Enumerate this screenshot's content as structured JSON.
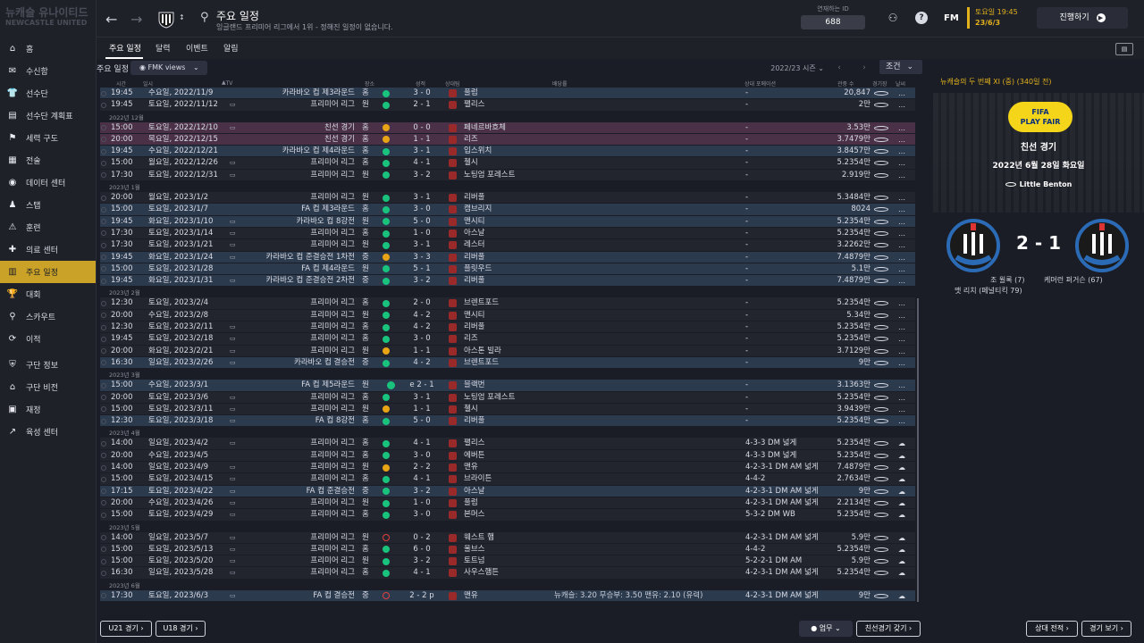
{
  "sidebar": {
    "club": [
      "뉴캐슬 유나이티드",
      "NEWCASTLE UNITED"
    ],
    "items": [
      {
        "label": "홈",
        "icon": "home-icon"
      },
      {
        "label": "수신함",
        "icon": "inbox-icon"
      },
      {
        "label": "선수단",
        "icon": "shirt-icon"
      },
      {
        "label": "선수단 계획표",
        "icon": "clipboard-icon"
      },
      {
        "label": "세력 구도",
        "icon": "hierarchy-icon"
      },
      {
        "label": "전술",
        "icon": "tactics-icon"
      },
      {
        "label": "데이터 센터",
        "icon": "data-icon"
      },
      {
        "label": "스탭",
        "icon": "staff-icon"
      },
      {
        "label": "훈련",
        "icon": "training-icon"
      },
      {
        "label": "의료 센터",
        "icon": "medical-icon"
      },
      {
        "label": "주요 일정",
        "icon": "calendar-icon",
        "active": true
      },
      {
        "label": "대회",
        "icon": "trophy-icon"
      },
      {
        "label": "스카우트",
        "icon": "scout-icon"
      },
      {
        "label": "이적",
        "icon": "transfer-icon"
      },
      {
        "label": "구단 정보",
        "icon": "shield-icon"
      },
      {
        "label": "구단 비전",
        "icon": "vision-icon"
      },
      {
        "label": "재정",
        "icon": "finance-icon"
      },
      {
        "label": "육성 센터",
        "icon": "development-icon"
      }
    ]
  },
  "header": {
    "title": "주요 일정",
    "subtitle": "잉글랜드 프리미어 리그에서 1위 - 정해진 일정이 없습니다.",
    "id_label": "연재하는 ID",
    "id_value": "688",
    "fm": "FM",
    "date_line1": "토요일 19:45",
    "date_line2": "23/6/3",
    "continue": "진행하기"
  },
  "tabs": [
    "주요 일정",
    "달력",
    "이벤트",
    "알림"
  ],
  "filters": {
    "label": "주요 일정",
    "views": "FMK views",
    "season": "2022/23 시즌",
    "conditions": "조건"
  },
  "columns": [
    "시간",
    "일시",
    "TV 대회",
    "장소",
    "성적",
    "상대팀",
    "배당률",
    "상대 포메이션",
    "관중 수",
    "경기장",
    "날씨"
  ],
  "rows": [
    {
      "type": "row",
      "time": "19:45",
      "date": "수요일, 2022/11/9",
      "tv": false,
      "comp": "카라바오 컵 제3라운드",
      "venue": "홈",
      "ind": "g",
      "res": "3 - 0",
      "opp": "풀럼",
      "note": "",
      "form": "-",
      "att": "20,847",
      "style": "alt"
    },
    {
      "type": "row",
      "time": "19:45",
      "date": "토요일, 2022/11/12",
      "tv": true,
      "comp": "프리미어 리그",
      "venue": "원",
      "ind": "g",
      "res": "2 - 1",
      "opp": "팰리스",
      "note": "",
      "form": "-",
      "att": "2만",
      "style": ""
    },
    {
      "type": "month",
      "label": "2022년 12월"
    },
    {
      "type": "row",
      "time": "15:00",
      "date": "토요일, 2022/12/10",
      "tv": true,
      "comp": "친선 경기",
      "venue": "홈",
      "ind": "y",
      "res": "0 - 0",
      "opp": "페네르바흐체",
      "note": "",
      "form": "-",
      "att": "3.53만",
      "style": "cup"
    },
    {
      "type": "row",
      "time": "20:00",
      "date": "목요일, 2022/12/15",
      "tv": false,
      "comp": "친선 경기",
      "venue": "홈",
      "ind": "y",
      "res": "1 - 1",
      "opp": "리즈",
      "note": "",
      "form": "-",
      "att": "3.7479만",
      "style": "cup"
    },
    {
      "type": "row",
      "time": "19:45",
      "date": "수요일, 2022/12/21",
      "tv": false,
      "comp": "카라바오 컵 제4라운드",
      "venue": "홈",
      "ind": "g",
      "res": "3 - 1",
      "opp": "입스위치",
      "note": "",
      "form": "-",
      "att": "3.8457만",
      "style": "alt"
    },
    {
      "type": "row",
      "time": "15:00",
      "date": "월요일, 2022/12/26",
      "tv": true,
      "comp": "프리미어 리그",
      "venue": "홈",
      "ind": "g",
      "res": "4 - 1",
      "opp": "첼시",
      "note": "",
      "form": "-",
      "att": "5.2354만",
      "style": ""
    },
    {
      "type": "row",
      "time": "17:30",
      "date": "토요일, 2022/12/31",
      "tv": true,
      "comp": "프리미어 리그",
      "venue": "원",
      "ind": "g",
      "res": "3 - 2",
      "opp": "노팅엄 포레스트",
      "note": "",
      "form": "-",
      "att": "2.919만",
      "style": ""
    },
    {
      "type": "month",
      "label": "2023년 1월"
    },
    {
      "type": "row",
      "time": "20:00",
      "date": "월요일, 2023/1/2",
      "tv": false,
      "comp": "프리미어 리그",
      "venue": "원",
      "ind": "g",
      "res": "3 - 1",
      "opp": "리버풀",
      "note": "",
      "form": "-",
      "att": "5.3484만",
      "style": ""
    },
    {
      "type": "row",
      "time": "15:00",
      "date": "토요일, 2023/1/7",
      "tv": false,
      "comp": "FA 컵 제3라운드",
      "venue": "홈",
      "ind": "g",
      "res": "3 - 0",
      "opp": "캠브리지",
      "note": "",
      "form": "-",
      "att": "8024",
      "style": "alt"
    },
    {
      "type": "row",
      "time": "19:45",
      "date": "화요일, 2023/1/10",
      "tv": true,
      "comp": "카라바오 컵 8강전",
      "venue": "원",
      "ind": "g",
      "res": "5 - 0",
      "opp": "맨시티",
      "note": "",
      "form": "-",
      "att": "5.2354만",
      "style": "alt"
    },
    {
      "type": "row",
      "time": "17:30",
      "date": "토요일, 2023/1/14",
      "tv": true,
      "comp": "프리미어 리그",
      "venue": "홈",
      "ind": "g",
      "res": "1 - 0",
      "opp": "아스날",
      "note": "",
      "form": "-",
      "att": "5.2354만",
      "style": ""
    },
    {
      "type": "row",
      "time": "17:30",
      "date": "토요일, 2023/1/21",
      "tv": true,
      "comp": "프리미어 리그",
      "venue": "원",
      "ind": "g",
      "res": "3 - 1",
      "opp": "레스터",
      "note": "",
      "form": "-",
      "att": "3.2262만",
      "style": ""
    },
    {
      "type": "row",
      "time": "19:45",
      "date": "화요일, 2023/1/24",
      "tv": true,
      "comp": "카라바오 컵 준결승전 1차전",
      "venue": "중",
      "ind": "y",
      "res": "3 - 3",
      "opp": "리버풀",
      "note": "",
      "form": "-",
      "att": "7.4879만",
      "style": "alt"
    },
    {
      "type": "row",
      "time": "15:00",
      "date": "토요일, 2023/1/28",
      "tv": false,
      "comp": "FA 컵 제4라운드",
      "venue": "원",
      "ind": "g",
      "res": "5 - 1",
      "opp": "플릿우드",
      "note": "",
      "form": "-",
      "att": "5.1만",
      "style": "alt"
    },
    {
      "type": "row",
      "time": "19:45",
      "date": "화요일, 2023/1/31",
      "tv": true,
      "comp": "카라바오 컵 준결승전 2차전",
      "venue": "중",
      "ind": "g",
      "res": "3 - 2",
      "opp": "리버풀",
      "note": "",
      "form": "-",
      "att": "7.4879만",
      "style": "alt"
    },
    {
      "type": "month",
      "label": "2023년 2월"
    },
    {
      "type": "row",
      "time": "12:30",
      "date": "토요일, 2023/2/4",
      "tv": false,
      "comp": "프리미어 리그",
      "venue": "홈",
      "ind": "g",
      "res": "2 - 0",
      "opp": "브렌트포드",
      "note": "",
      "form": "-",
      "att": "5.2354만",
      "style": ""
    },
    {
      "type": "row",
      "time": "20:00",
      "date": "수요일, 2023/2/8",
      "tv": false,
      "comp": "프리미어 리그",
      "venue": "원",
      "ind": "g",
      "res": "4 - 2",
      "opp": "맨시티",
      "note": "",
      "form": "-",
      "att": "5.34만",
      "style": ""
    },
    {
      "type": "row",
      "time": "12:30",
      "date": "토요일, 2023/2/11",
      "tv": true,
      "comp": "프리미어 리그",
      "venue": "홈",
      "ind": "g",
      "res": "4 - 2",
      "opp": "리버풀",
      "note": "",
      "form": "-",
      "att": "5.2354만",
      "style": ""
    },
    {
      "type": "row",
      "time": "19:45",
      "date": "토요일, 2023/2/18",
      "tv": true,
      "comp": "프리미어 리그",
      "venue": "홈",
      "ind": "g",
      "res": "3 - 0",
      "opp": "리즈",
      "note": "",
      "form": "-",
      "att": "5.2354만",
      "style": ""
    },
    {
      "type": "row",
      "time": "20:00",
      "date": "화요일, 2023/2/21",
      "tv": true,
      "comp": "프리미어 리그",
      "venue": "원",
      "ind": "y",
      "res": "1 - 1",
      "opp": "아스톤 빌라",
      "note": "",
      "form": "-",
      "att": "3.7129만",
      "style": ""
    },
    {
      "type": "row",
      "time": "16:30",
      "date": "일요일, 2023/2/26",
      "tv": true,
      "comp": "카라바오 컵 결승전",
      "venue": "중",
      "ind": "g",
      "res": "4 - 2",
      "opp": "브렌트포드",
      "note": "",
      "form": "-",
      "att": "9만",
      "style": "alt"
    },
    {
      "type": "month",
      "label": "2023년 3월"
    },
    {
      "type": "row",
      "time": "15:00",
      "date": "수요일, 2023/3/1",
      "tv": false,
      "comp": "FA 컵 제5라운드",
      "venue": "원",
      "ind": "b",
      "res": "e 2 - 1",
      "opp": "블랙번",
      "note": "",
      "form": "-",
      "att": "3.1363만",
      "style": "alt"
    },
    {
      "type": "row",
      "time": "20:00",
      "date": "토요일, 2023/3/6",
      "tv": true,
      "comp": "프리미어 리그",
      "venue": "홈",
      "ind": "g",
      "res": "3 - 1",
      "opp": "노팅엄 포레스트",
      "note": "",
      "form": "-",
      "att": "5.2354만",
      "style": ""
    },
    {
      "type": "row",
      "time": "15:00",
      "date": "토요일, 2023/3/11",
      "tv": true,
      "comp": "프리미어 리그",
      "venue": "원",
      "ind": "y",
      "res": "1 - 1",
      "opp": "첼시",
      "note": "",
      "form": "-",
      "att": "3.9439만",
      "style": ""
    },
    {
      "type": "row",
      "time": "12:30",
      "date": "토요일, 2023/3/18",
      "tv": true,
      "comp": "FA 컵 8강전",
      "venue": "홈",
      "ind": "g",
      "res": "5 - 0",
      "opp": "리버풀",
      "note": "",
      "form": "-",
      "att": "5.2354만",
      "style": "alt"
    },
    {
      "type": "month",
      "label": "2023년 4월"
    },
    {
      "type": "row",
      "time": "14:00",
      "date": "일요일, 2023/4/2",
      "tv": true,
      "comp": "프리미어 리그",
      "venue": "홈",
      "ind": "g",
      "res": "4 - 1",
      "opp": "팰리스",
      "note": "",
      "form": "4-3-3 DM 넓게",
      "att": "5.2354만",
      "style": ""
    },
    {
      "type": "row",
      "time": "20:00",
      "date": "수요일, 2023/4/5",
      "tv": false,
      "comp": "프리미어 리그",
      "venue": "홈",
      "ind": "g",
      "res": "3 - 0",
      "opp": "에버튼",
      "note": "",
      "form": "4-3-3 DM 넓게",
      "att": "5.2354만",
      "style": ""
    },
    {
      "type": "row",
      "time": "14:00",
      "date": "일요일, 2023/4/9",
      "tv": true,
      "comp": "프리미어 리그",
      "venue": "원",
      "ind": "y",
      "res": "2 - 2",
      "opp": "맨유",
      "note": "",
      "form": "4-2-3-1 DM AM 넓게",
      "att": "7.4879만",
      "style": ""
    },
    {
      "type": "row",
      "time": "15:00",
      "date": "토요일, 2023/4/15",
      "tv": true,
      "comp": "프리미어 리그",
      "venue": "홈",
      "ind": "g",
      "res": "4 - 1",
      "opp": "브라이튼",
      "note": "",
      "form": "4-4-2",
      "att": "2.7634만",
      "style": ""
    },
    {
      "type": "row",
      "time": "17:15",
      "date": "토요일, 2023/4/22",
      "tv": true,
      "comp": "FA 컵 준결승전",
      "venue": "중",
      "ind": "g",
      "res": "3 - 2",
      "opp": "아스날",
      "note": "",
      "form": "4-2-3-1 DM AM 넓게",
      "att": "9만",
      "style": "alt"
    },
    {
      "type": "row",
      "time": "20:00",
      "date": "수요일, 2023/4/26",
      "tv": true,
      "comp": "프리미어 리그",
      "venue": "원",
      "ind": "g",
      "res": "1 - 0",
      "opp": "풀럼",
      "note": "",
      "form": "4-2-3-1 DM AM 넓게",
      "att": "2.2134만",
      "style": ""
    },
    {
      "type": "row",
      "time": "15:00",
      "date": "토요일, 2023/4/29",
      "tv": true,
      "comp": "프리미어 리그",
      "venue": "홈",
      "ind": "g",
      "res": "3 - 0",
      "opp": "본머스",
      "note": "",
      "form": "5-3-2 DM WB",
      "att": "5.2354만",
      "style": ""
    },
    {
      "type": "month",
      "label": "2023년 5월"
    },
    {
      "type": "row",
      "time": "14:00",
      "date": "일요일, 2023/5/7",
      "tv": true,
      "comp": "프리미어 리그",
      "venue": "원",
      "ind": "r",
      "res": "0 - 2",
      "opp": "웨스트 햄",
      "note": "",
      "form": "4-2-3-1 DM AM 넓게",
      "att": "5.9만",
      "style": ""
    },
    {
      "type": "row",
      "time": "15:00",
      "date": "토요일, 2023/5/13",
      "tv": true,
      "comp": "프리미어 리그",
      "venue": "홈",
      "ind": "g",
      "res": "6 - 0",
      "opp": "울브스",
      "note": "",
      "form": "4-4-2",
      "att": "5.2354만",
      "style": ""
    },
    {
      "type": "row",
      "time": "15:00",
      "date": "토요일, 2023/5/20",
      "tv": true,
      "comp": "프리미어 리그",
      "venue": "원",
      "ind": "g",
      "res": "3 - 2",
      "opp": "토트넘",
      "note": "",
      "form": "5-2-2-1 DM AM",
      "att": "5.9만",
      "style": ""
    },
    {
      "type": "row",
      "time": "16:30",
      "date": "일요일, 2023/5/28",
      "tv": true,
      "comp": "프리미어 리그",
      "venue": "홈",
      "ind": "g",
      "res": "4 - 1",
      "opp": "사우스햄튼",
      "note": "",
      "form": "4-2-3-1 DM AM 넓게",
      "att": "5.2354만",
      "style": ""
    },
    {
      "type": "month",
      "label": "2023년 6월"
    },
    {
      "type": "row",
      "time": "17:30",
      "date": "토요일, 2023/6/3",
      "tv": true,
      "comp": "FA 컵 결승전",
      "venue": "중",
      "ind": "r",
      "res": "2 - 2 p",
      "opp": "맨유",
      "note": "뉴캐슬: 3.20  무승부: 3.50  맨유: 2.10 (유력)",
      "form": "4-2-3-1 DM AM 넓게",
      "att": "9만",
      "style": "alt"
    }
  ],
  "bottom": {
    "u21": "U21 경기",
    "u18": "U18 경기",
    "tasks": "업무",
    "friendly": "친선경기 갖기",
    "h2h": "상대 전적",
    "view_match": "경기 보기"
  },
  "panel": {
    "title": "뉴캐슬의 두 번째 XI (중) (340일 전)",
    "badge_line1": "FIFA",
    "badge_line2": "PLAY FAIR",
    "match_type": "친선 경기",
    "date": "2022년 6월 28일 화요일",
    "venue": "Little Benton",
    "score": "2 - 1",
    "home_scorer": "조 윌록 (7)",
    "home_scorer2": "맷 리치 (페널티킥 79)",
    "away_scorer": "케머런 퍼거슨 (67)"
  },
  "colors": {
    "accent": "#c9a227",
    "win": "#19c37d",
    "draw": "#e8a414",
    "loss": "#e0413e"
  }
}
